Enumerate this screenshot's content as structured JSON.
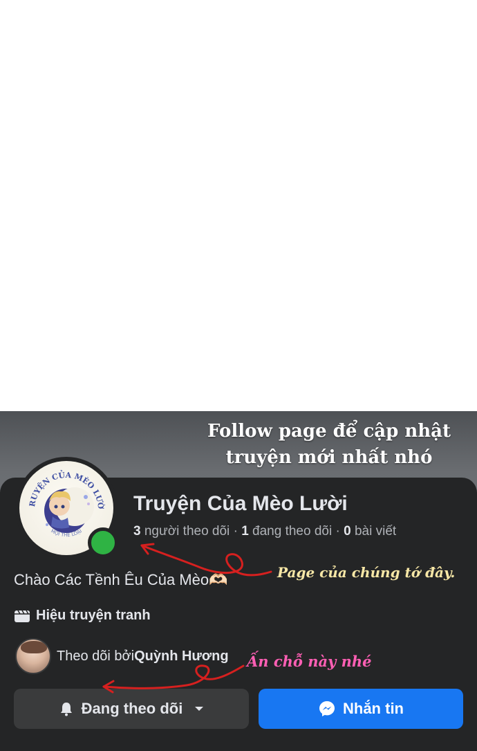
{
  "headline": {
    "line1": "Follow page để cập nhật",
    "line2": "truyện mới nhất nhó"
  },
  "page": {
    "name": "Truyện Của Mèo Lười",
    "stats": {
      "followers_count": "3",
      "followers_label": " người theo dõi",
      "following_count": "1",
      "following_label": " đang theo dõi",
      "posts_count": "0",
      "posts_label": " bài viết",
      "separator": " · "
    },
    "avatar_logo_text": "TRUYỆN CỦA MÈO LƯỜI",
    "avatar_logo_subtext": "MỌI THỂ LOẠI",
    "online_status_color": "#2fb344",
    "bio": "Chào Các Tềnh Êu Của Mèo🫶🏻",
    "category_icon": "clapperboard-icon",
    "category": "Hiệu truyện tranh",
    "followed_by_label": "Theo dõi bởi ",
    "followed_by_name": "Quỳnh Hương"
  },
  "buttons": {
    "following_icon": "bell-icon",
    "following_label": "Đang theo dõi",
    "following_dropdown_icon": "caret-down-icon",
    "message_icon": "messenger-icon",
    "message_label": "Nhắn tin"
  },
  "annotations": {
    "page_note": "Page của chúng tớ đây.",
    "tap_note": "Ấn chỗ này nhé",
    "page_note_color": "#f7e7a6",
    "tap_note_color": "#ff5fb4",
    "arrow_color": "#d6201f"
  },
  "colors": {
    "card_bg": "#242526",
    "primary_text": "#e4e6eb",
    "secondary_text": "#b0b3b8",
    "message_button": "#1877f2",
    "following_button": "#3a3b3c"
  }
}
